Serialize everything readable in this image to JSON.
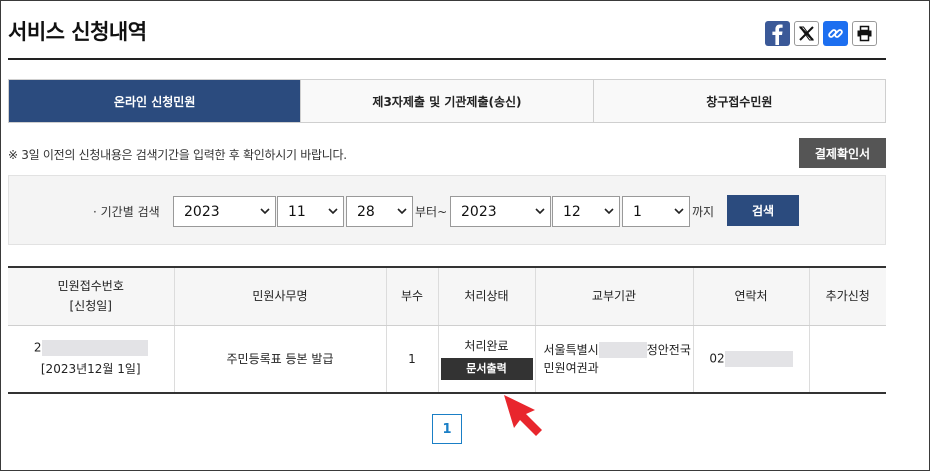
{
  "page_title": "서비스 신청내역",
  "share": {
    "facebook_icon": "facebook-icon",
    "x_icon": "x-icon",
    "link_icon": "link-icon",
    "print_icon": "print-icon"
  },
  "tabs": [
    {
      "label": "온라인 신청민원",
      "active": true
    },
    {
      "label": "제3자제출 및 기관제출(송신)",
      "active": false
    },
    {
      "label": "창구접수민원",
      "active": false
    }
  ],
  "notice": "※ 3일 이전의 신청내용은 검색기간을 입력한 후 확인하시기 바랍니다.",
  "receipt_button": "결제확인서",
  "search": {
    "label": "· 기간별 검색",
    "start_year": "2023",
    "start_month": "11",
    "start_day": "28",
    "from_text": "부터~",
    "end_year": "2023",
    "end_month": "12",
    "end_day": "1",
    "until_text": "까지",
    "button": "검색"
  },
  "table": {
    "headers": {
      "receipt_no_line1": "민원접수번호",
      "receipt_no_line2": "[신청일]",
      "service_name": "민원사무명",
      "copies": "부수",
      "status": "처리상태",
      "agency": "교부기관",
      "contact": "연락처",
      "extra": "추가신청"
    },
    "rows": [
      {
        "receipt_no": "2",
        "date": "[2023년12월 1일]",
        "service_name": "주민등록표 등본 발급",
        "copies": "1",
        "status": "처리완료",
        "print_button": "문서출력",
        "agency_prefix": "서울특별시",
        "agency_suffix": "정안전국",
        "agency_line2": "민원여권과",
        "contact": "02",
        "extra": ""
      }
    ]
  },
  "pagination": {
    "current": "1"
  },
  "colors": {
    "primary": "#2b4b7e",
    "dark_button": "#555555",
    "pager": "#1a7fc6",
    "arrow": "#e8262d"
  }
}
